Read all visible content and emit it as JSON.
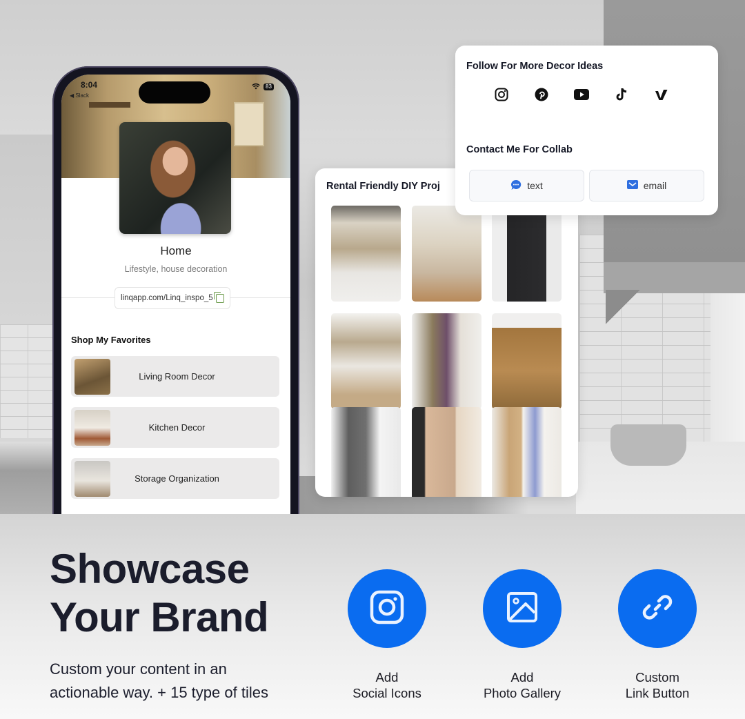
{
  "phone": {
    "status_time": "8:04",
    "back_label": "◀ Slack",
    "battery": "83",
    "profile_name": "Home",
    "profile_subtitle": "Lifestyle, house decoration",
    "profile_link": "linqapp.com/Linq_inspo_5",
    "section_title": "Shop My Favorites",
    "links": [
      {
        "label": "Living Room Decor",
        "thumb_color": "#8a7048"
      },
      {
        "label": "Kitchen Decor",
        "thumb_color": "#b59a7c"
      },
      {
        "label": "Storage Organization",
        "thumb_color": "#cfcac2"
      }
    ]
  },
  "gallery": {
    "title": "Rental Friendly DIY Proj",
    "tiles": [
      {
        "name": "pantry-jars",
        "color": "#a9a49a"
      },
      {
        "name": "kitchen-shelf",
        "color": "#d8d0c0"
      },
      {
        "name": "chalkboard-calendar",
        "color": "#2e2e30"
      },
      {
        "name": "under-sink-storage",
        "color": "#c7bfb2"
      },
      {
        "name": "hanging-produce-bags",
        "color": "#b6a590"
      },
      {
        "name": "wood-cabinet-baskets",
        "color": "#a57e4c"
      },
      {
        "name": "utility-closet",
        "color": "#8f8f8f"
      },
      {
        "name": "sliding-barn-door",
        "color": "#c8a88c"
      },
      {
        "name": "wall-shelf-cabinet",
        "color": "#d9cdb8"
      }
    ]
  },
  "social_card": {
    "title": "Follow For More Decor Ideas",
    "icons": [
      "instagram-icon",
      "pinterest-icon",
      "youtube-icon",
      "tiktok-icon",
      "vimeo-icon"
    ],
    "contact_title": "Contact Me For Collab",
    "buttons": [
      {
        "label": "text",
        "icon": "chat-bubble-icon"
      },
      {
        "label": "email",
        "icon": "mail-icon"
      }
    ],
    "accent": "#2f6fe0"
  },
  "promo": {
    "headline_line1": "Showcase",
    "headline_line2": "Your Brand",
    "sub_line1": "Custom your content in an",
    "sub_line2": "actionable way. + 15 type of tiles",
    "brand_color": "#0a6cf0",
    "features": [
      {
        "line1": "Add",
        "line2": "Social Icons",
        "icon": "instagram-icon"
      },
      {
        "line1": "Add",
        "line2": "Photo Gallery",
        "icon": "image-icon"
      },
      {
        "line1": "Custom",
        "line2": "Link Button",
        "icon": "link-icon"
      }
    ]
  }
}
